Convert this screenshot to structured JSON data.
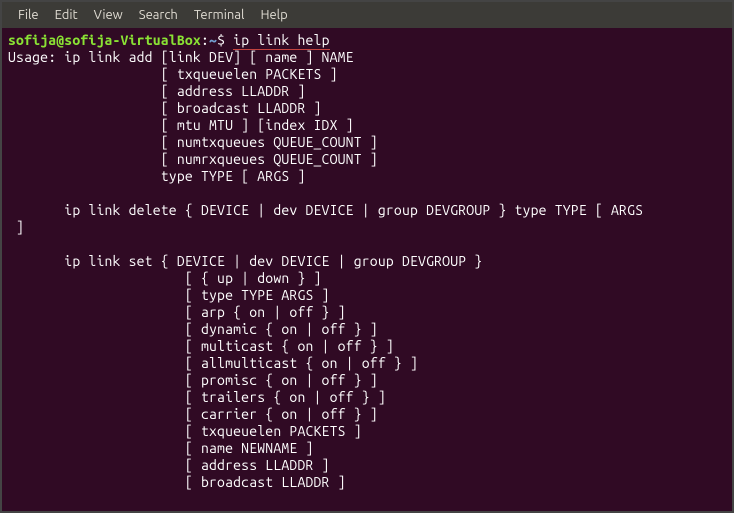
{
  "menubar": {
    "items": [
      "File",
      "Edit",
      "View",
      "Search",
      "Terminal",
      "Help"
    ]
  },
  "prompt": {
    "userhost": "sofija@sofija-VirtualBox",
    "colon": ":",
    "path": "~",
    "dollar": "$"
  },
  "command": "ip link help",
  "output_lines": [
    "Usage: ip link add [link DEV] [ name ] NAME",
    "                   [ txqueuelen PACKETS ]",
    "                   [ address LLADDR ]",
    "                   [ broadcast LLADDR ]",
    "                   [ mtu MTU ] [index IDX ]",
    "                   [ numtxqueues QUEUE_COUNT ]",
    "                   [ numrxqueues QUEUE_COUNT ]",
    "                   type TYPE [ ARGS ]",
    "",
    "       ip link delete { DEVICE | dev DEVICE | group DEVGROUP } type TYPE [ ARGS",
    " ]",
    "",
    "       ip link set { DEVICE | dev DEVICE | group DEVGROUP }",
    "                      [ { up | down } ]",
    "                      [ type TYPE ARGS ]",
    "                      [ arp { on | off } ]",
    "                      [ dynamic { on | off } ]",
    "                      [ multicast { on | off } ]",
    "                      [ allmulticast { on | off } ]",
    "                      [ promisc { on | off } ]",
    "                      [ trailers { on | off } ]",
    "                      [ carrier { on | off } ]",
    "                      [ txqueuelen PACKETS ]",
    "                      [ name NEWNAME ]",
    "                      [ address LLADDR ]",
    "                      [ broadcast LLADDR ]"
  ]
}
